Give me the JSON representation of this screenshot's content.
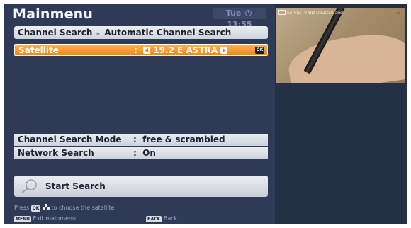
{
  "header": {
    "title": "Mainmenu",
    "day": "Tue",
    "time": "13:55"
  },
  "breadcrumb": {
    "parent": "Channel Search",
    "current": "Automatic Channel Search"
  },
  "settings": {
    "satellite": {
      "label": "Satellite",
      "separator": ":",
      "value": "19.2 E ASTRA",
      "badge": "OK"
    },
    "search_mode": {
      "label": "Channel Search Mode",
      "separator": ":",
      "value": "free & scrambled"
    },
    "network_search": {
      "label": "Network Search",
      "separator": ":",
      "value": "On"
    }
  },
  "start_button": {
    "label": "Start Search"
  },
  "hint": {
    "prefix": "Press",
    "ok_key": "OK",
    "suffix": "to choose the satellite"
  },
  "footer": {
    "menu_key": "MENU",
    "menu_label": "Exit mainmenu",
    "back_key": "BACK",
    "back_label": "Back"
  },
  "preview": {
    "channel": "ServusTV HD Deutschland"
  },
  "colors": {
    "background": "#2f3a56",
    "selected_row": "#f0861a",
    "row": "#dfe3e9",
    "text_dark": "#1d2233",
    "hint_text": "#9aa6c0"
  },
  "icons": [
    "clock-icon",
    "arrow-left-icon",
    "arrow-right-icon",
    "search-icon",
    "nav-arrows-icon",
    "tv-icon"
  ]
}
